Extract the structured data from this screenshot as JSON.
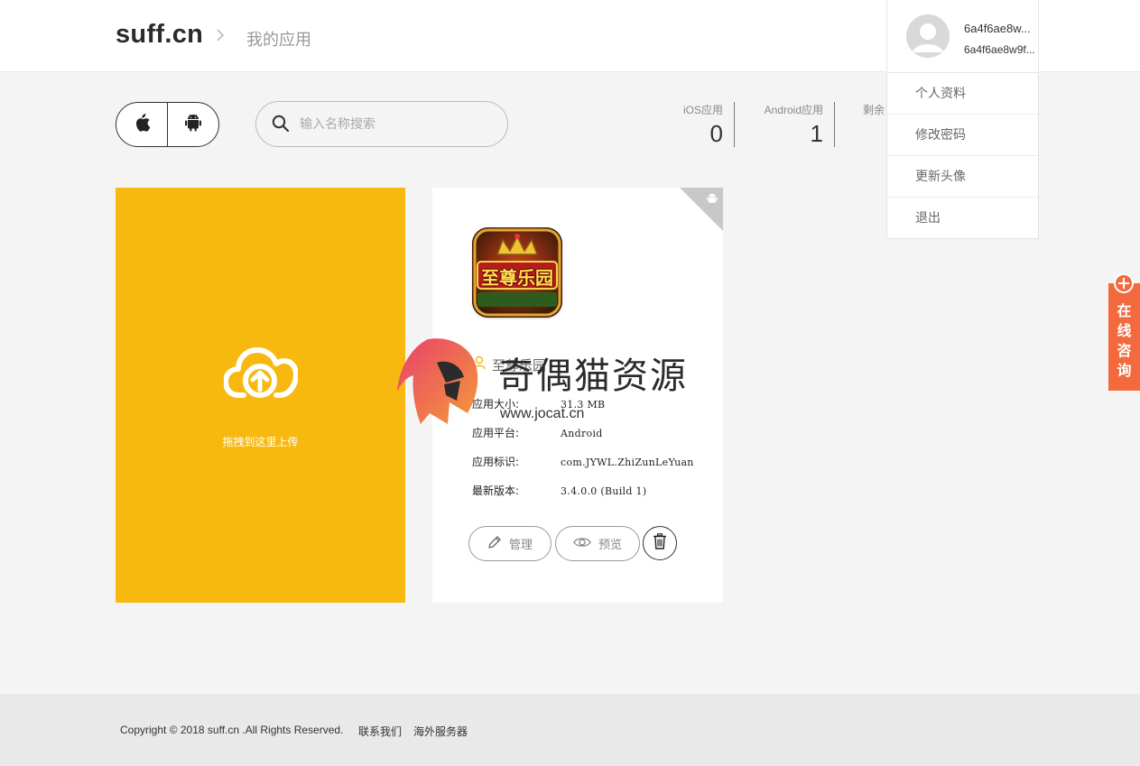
{
  "header": {
    "logo": "suff.cn",
    "breadcrumb": "我的应用"
  },
  "user": {
    "name": "6a4f6ae8w...",
    "id": "6a4f6ae8w9f...",
    "menu": [
      "个人资料",
      "修改密码",
      "更新头像",
      "退出"
    ]
  },
  "toolbar": {
    "platform_icons": [
      "apple-icon",
      "android-icon"
    ],
    "search_placeholder": "输入名称搜索"
  },
  "stats": [
    {
      "label": "iOS应用",
      "value": "0"
    },
    {
      "label": "Android应用",
      "value": "1"
    },
    {
      "label": "剩余",
      "value": ""
    }
  ],
  "upload": {
    "label": "拖拽到这里上传",
    "color": "#f7b90f"
  },
  "app": {
    "icon_text": "至尊乐园",
    "name": "至尊乐园",
    "fields": [
      {
        "key": "应用大小:",
        "value": "31.3 MB"
      },
      {
        "key": "应用平台:",
        "value": "Android"
      },
      {
        "key": "应用标识:",
        "value": "com.JYWL.ZhiZunLeYuan"
      },
      {
        "key": "最新版本:",
        "value": "3.4.0.0 (Build 1)"
      }
    ],
    "buttons": {
      "manage": "管理",
      "preview": "预览"
    }
  },
  "watermark": {
    "text": "奇偶猫资源",
    "url": "www.jocat.cn"
  },
  "consult": {
    "label": "在线咨询",
    "color": "#f26a3d"
  },
  "footer": {
    "copyright": "Copyright © 2018 suff.cn .All Rights Reserved.",
    "links": [
      "联系我们",
      "海外服务器"
    ]
  }
}
